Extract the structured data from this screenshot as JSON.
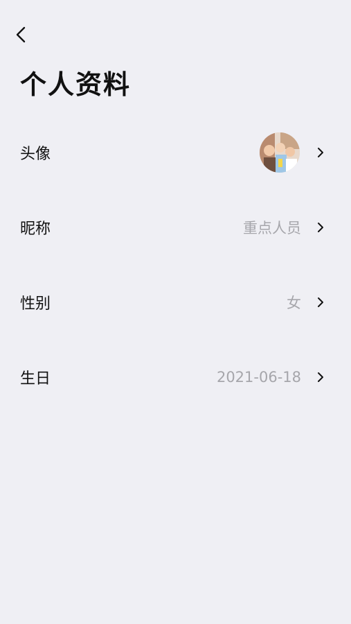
{
  "header": {
    "title": "个人资料"
  },
  "rows": [
    {
      "label": "头像"
    },
    {
      "label": "昵称",
      "value": "重点人员"
    },
    {
      "label": "性别",
      "value": "女"
    },
    {
      "label": "生日",
      "value": "2021-06-18"
    }
  ],
  "icons": {
    "back": "chevron-left-icon",
    "row_arrow": "chevron-right-icon"
  },
  "colors": {
    "background": "#efeff4",
    "text_primary": "#111111",
    "text_secondary": "#a6a6ab"
  }
}
